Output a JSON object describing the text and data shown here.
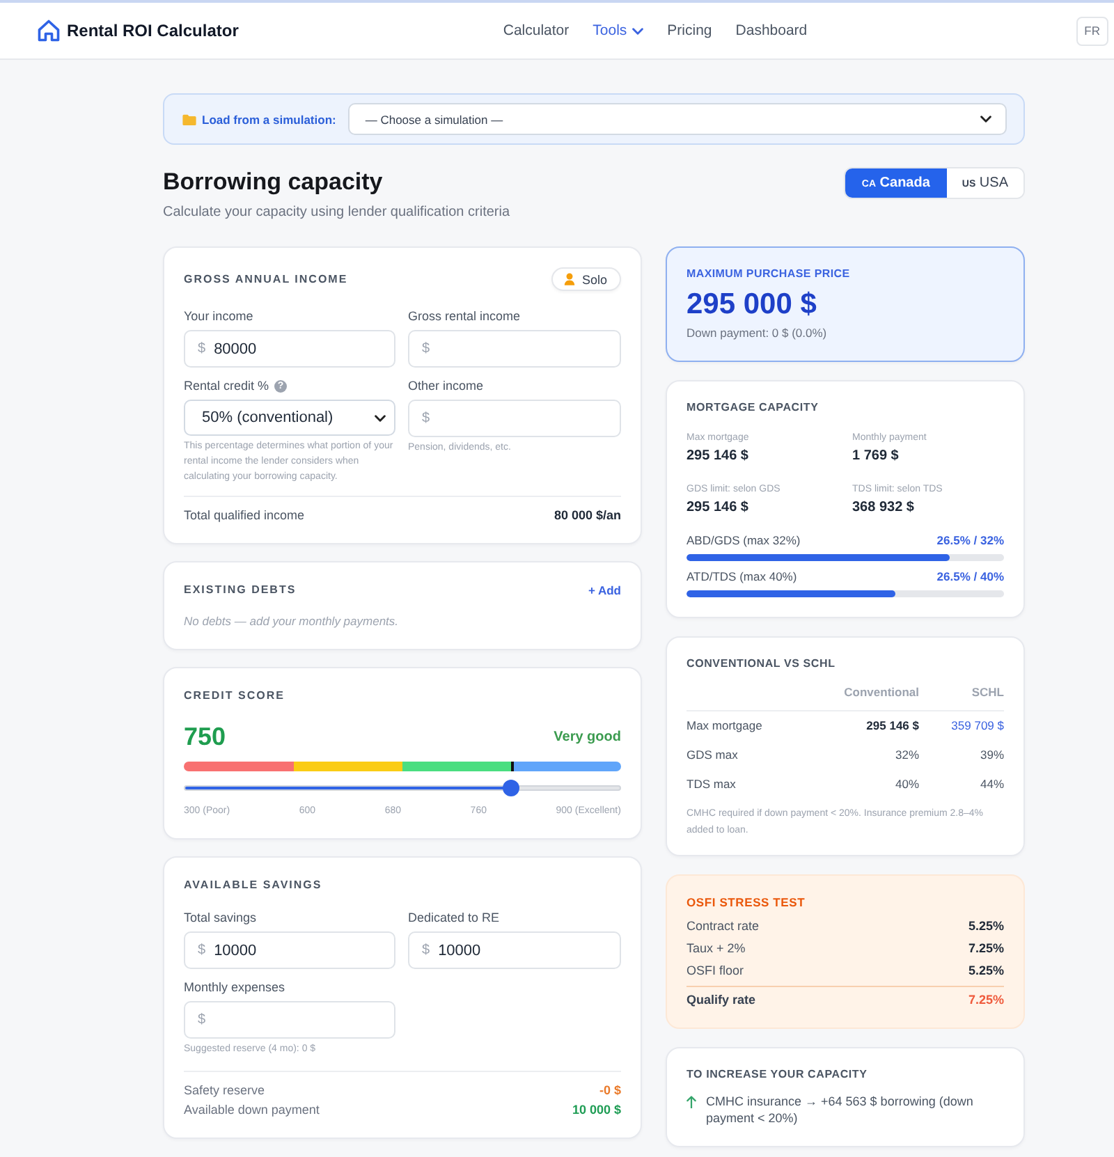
{
  "header": {
    "brand": "Rental ROI Calculator",
    "nav": [
      {
        "label": "Calculator",
        "selected": false,
        "dropdown": false
      },
      {
        "label": "Tools",
        "selected": true,
        "dropdown": true
      },
      {
        "label": "Pricing",
        "selected": false,
        "dropdown": false
      },
      {
        "label": "Dashboard",
        "selected": false,
        "dropdown": false
      }
    ],
    "language": "FR"
  },
  "simulation_loader": {
    "label": "Load from a simulation:",
    "value": "— Choose a simulation —"
  },
  "heading": {
    "title": "Borrowing capacity",
    "subtitle": "Calculate your capacity using lender qualification criteria"
  },
  "countries": [
    {
      "flag": "CA",
      "label": "Canada",
      "selected": true
    },
    {
      "flag": "US",
      "label": "USA",
      "selected": false
    }
  ],
  "income": {
    "title": "GROSS ANNUAL INCOME",
    "badge": "Solo",
    "fields": [
      {
        "kind": "input",
        "label": "Your income",
        "prefix": "$",
        "value": "80000"
      },
      {
        "kind": "input",
        "label": "Gross rental income",
        "prefix": "$"
      },
      {
        "kind": "select",
        "label": "Rental credit %",
        "help": "?",
        "value": "50% (conventional)",
        "hint": "This percentage determines what portion of your rental income the lender considers when calculating your borrowing capacity."
      },
      {
        "kind": "input",
        "label": "Other income",
        "prefix": "$",
        "hint": "Pension, dividends, etc."
      }
    ],
    "total": {
      "label": "Total qualified income",
      "value": "80 000 $/an"
    }
  },
  "debts": {
    "title": "EXISTING DEBTS",
    "action": "+ Add",
    "empty": "No debts — add your monthly payments."
  },
  "credit_score": {
    "title": "CREDIT SCORE",
    "score": "750",
    "rating": "Very good",
    "level": 0.75,
    "segments": [
      {
        "color": "#f87171"
      },
      {
        "color": "#facc15"
      },
      {
        "color": "#4ade80"
      },
      {
        "color": "#60a5fa"
      }
    ],
    "ticks": [
      "300 (Poor)",
      "600",
      "680",
      "760",
      "900 (Excellent)"
    ]
  },
  "savings": {
    "title": "AVAILABLE SAVINGS",
    "fields": [
      {
        "kind": "input",
        "label": "Total savings",
        "prefix": "$",
        "value": "10000"
      },
      {
        "kind": "input",
        "label": "Dedicated to RE",
        "prefix": "$",
        "value": "10000"
      },
      {
        "kind": "input",
        "label": "Monthly expenses",
        "prefix": "$",
        "hint": "Suggested reserve (4 mo): 0 $"
      }
    ],
    "summary": [
      {
        "kind": "warning",
        "label": "Safety reserve",
        "value": "-0 $"
      },
      {
        "kind": "positive",
        "label": "Available down payment",
        "value": "10 000 $"
      }
    ]
  },
  "max_price": {
    "label": "MAXIMUM PURCHASE PRICE",
    "value": "295 000 $",
    "note": "Down payment: 0 $ (0.0%)"
  },
  "mortgage": {
    "title": "MORTGAGE CAPACITY",
    "stats": [
      {
        "label": "Max mortgage",
        "value": "295 146 $"
      },
      {
        "label": "Monthly payment",
        "value": "1 769 $"
      },
      {
        "label": "GDS limit: selon GDS",
        "value": "295 146 $"
      },
      {
        "label": "TDS limit: selon TDS",
        "value": "368 932 $"
      }
    ],
    "ratios": [
      {
        "label": "ABD/GDS (max 32%)",
        "reading": "26.5% / 32%",
        "level": 0.83
      },
      {
        "label": "ATD/TDS (max 40%)",
        "reading": "26.5% / 40%",
        "level": 0.66
      }
    ]
  },
  "comparison": {
    "title": "CONVENTIONAL VS SCHL",
    "columns": [
      "Conventional",
      "SCHL"
    ],
    "rows": [
      {
        "kind": "highlight",
        "label": "Max mortgage",
        "values": [
          "295 146 $",
          "359 709 $"
        ]
      },
      {
        "kind": "plain",
        "label": "GDS max",
        "values": [
          "32%",
          "39%"
        ]
      },
      {
        "kind": "plain",
        "label": "TDS max",
        "values": [
          "40%",
          "44%"
        ]
      }
    ],
    "note": "CMHC required if down payment < 20%. Insurance premium 2.8–4% added to loan."
  },
  "stress_test": {
    "title": "OSFI STRESS TEST",
    "rows": [
      {
        "label": "Contract rate",
        "value": "5.25%"
      },
      {
        "label": "Taux + 2%",
        "value": "7.25%"
      },
      {
        "label": "OSFI floor",
        "value": "5.25%"
      }
    ],
    "result": {
      "label": "Qualify rate",
      "value": "7.25%"
    }
  },
  "tips": {
    "title": "TO INCREASE YOUR CAPACITY",
    "items": [
      "CMHC insurance → +64 563 $ borrowing (down payment < 20%)"
    ]
  }
}
